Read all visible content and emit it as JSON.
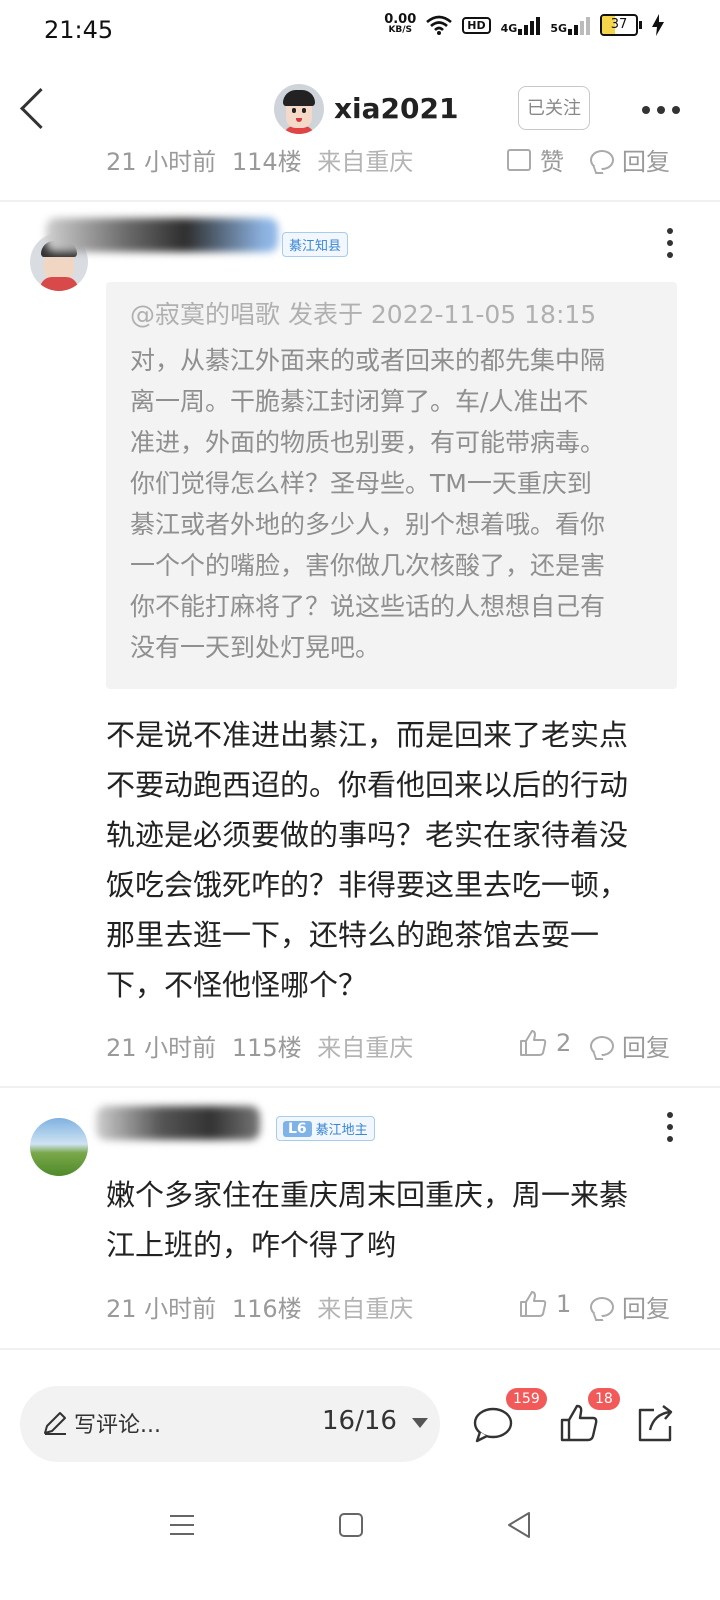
{
  "status_bar": {
    "time": "21:45",
    "net_speed_value": "0.00",
    "net_speed_unit": "KB/S",
    "hd_label": "HD",
    "sim1_label": "4G",
    "sim2_label": "5G",
    "battery": "37",
    "icons": [
      "wifi-icon",
      "signal-icon",
      "battery-icon",
      "charging-icon"
    ]
  },
  "header": {
    "username": "xia2021",
    "follow_label": "已关注"
  },
  "prev_comment": {
    "time": "21 小时前",
    "floor": "114楼",
    "location": "来自重庆",
    "like_label": "赞",
    "reply_label": "回复"
  },
  "comments": [
    {
      "badge": "綦江知县",
      "quote": {
        "header": "@寂寞的唱歌 发表于 2022-11-05 18:15",
        "lines": [
          "对，从綦江外面来的或者回来的都先集中隔",
          "离一周。干脆綦江封闭算了。车/人准出不",
          "准进，外面的物质也别要，有可能带病毒。",
          "你们觉得怎么样？圣母些。TM一天重庆到",
          "綦江或者外地的多少人，别个想着哦。看你",
          "一个个的嘴脸，害你做几次核酸了，还是害",
          "你不能打麻将了？说这些话的人想想自己有",
          "没有一天到处灯晃吧。"
        ]
      },
      "body_lines": [
        "不是说不准进出綦江，而是回来了老实点",
        "不要动跑西迢的。你看他回来以后的行动",
        "轨迹是必须要做的事吗？老实在家待着没",
        "饭吃会饿死咋的？非得要这里去吃一顿，",
        "那里去逛一下，还特么的跑茶馆去耍一",
        "下，不怪他怪哪个？"
      ],
      "time": "21 小时前",
      "floor": "115楼",
      "location": "来自重庆",
      "likes": "2",
      "reply_label": "回复"
    },
    {
      "level": "L6",
      "badge": "綦江地主",
      "body_lines": [
        "嫩个多家住在重庆周末回重庆，周一来綦",
        "江上班的，咋个得了哟"
      ],
      "time": "21 小时前",
      "floor": "116楼",
      "location": "来自重庆",
      "likes": "1",
      "reply_label": "回复"
    }
  ],
  "bottom_bar": {
    "input_label": "写评论...",
    "page_indicator": "16/16",
    "comment_count": "159",
    "like_count": "18"
  },
  "colors": {
    "badge_blue": "#3a86d4",
    "count_red": "#f25a5a",
    "battery_fill": "#f5d64a"
  }
}
